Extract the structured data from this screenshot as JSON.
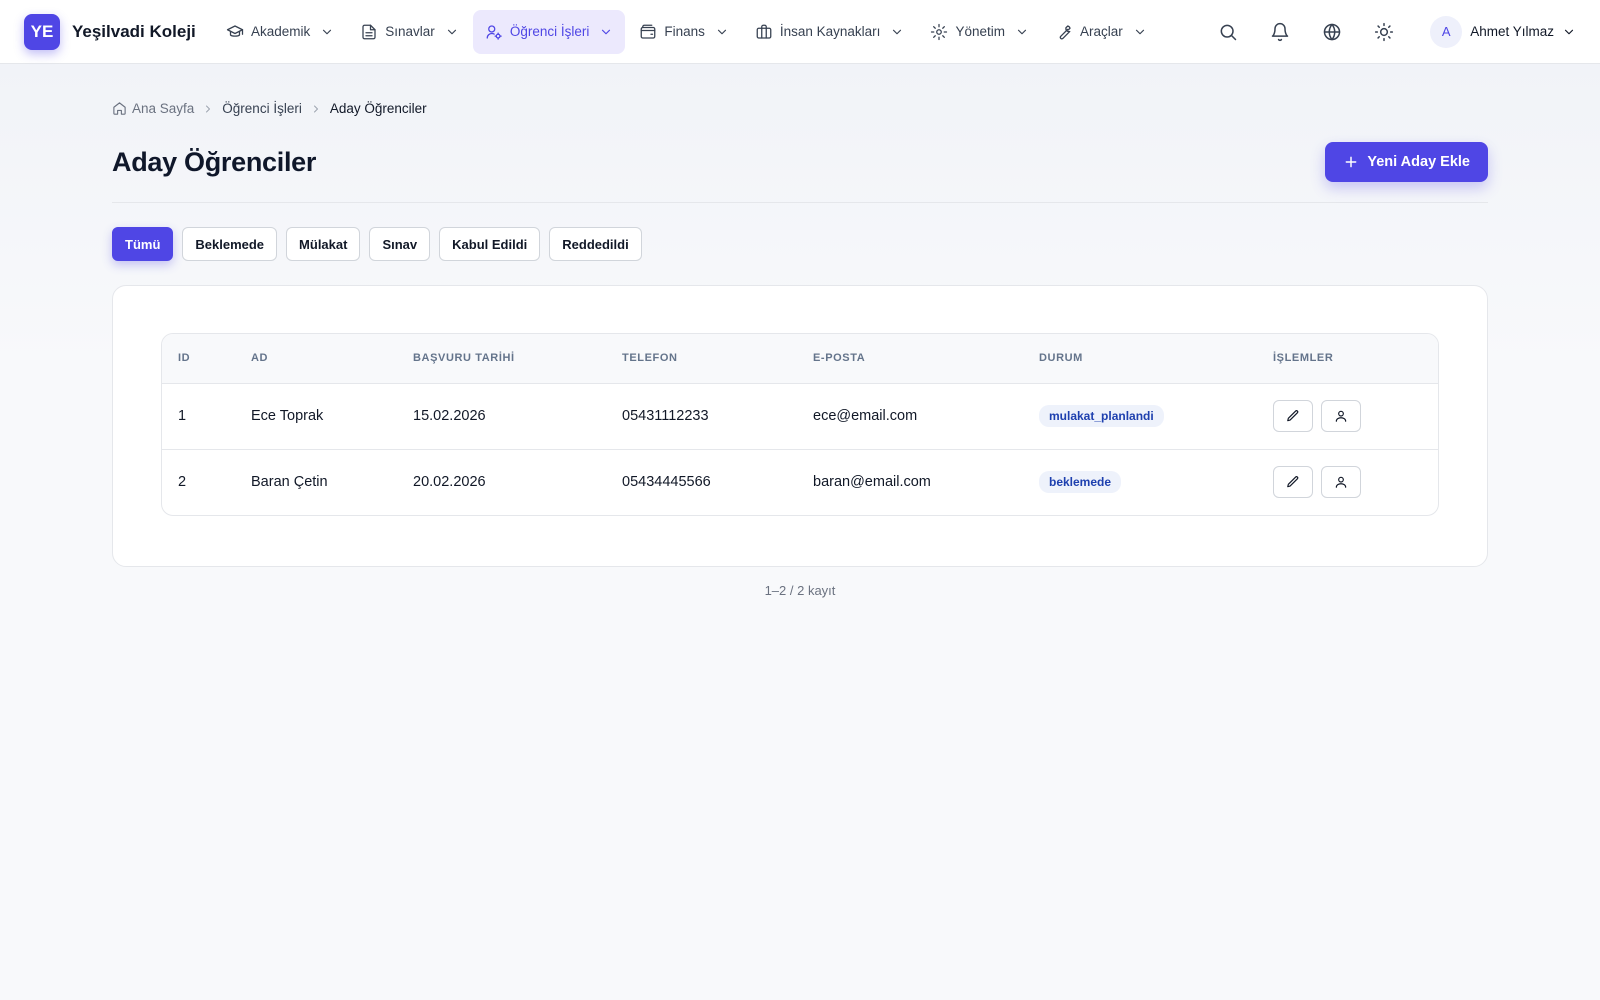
{
  "brand": {
    "logo_text": "YE",
    "name": "Yeşilvadi Koleji"
  },
  "nav": {
    "items": [
      {
        "label": "Akademik",
        "icon": "graduation-cap-icon"
      },
      {
        "label": "Sınavlar",
        "icon": "document-icon"
      },
      {
        "label": "Öğrenci İşleri",
        "icon": "user-cog-icon",
        "active": true
      },
      {
        "label": "Finans",
        "icon": "wallet-icon"
      },
      {
        "label": "İnsan Kaynakları",
        "icon": "briefcase-icon"
      },
      {
        "label": "Yönetim",
        "icon": "gear-icon"
      },
      {
        "label": "Araçlar",
        "icon": "wrench-icon"
      }
    ]
  },
  "topbar": {
    "tools": [
      "search-icon",
      "bell-icon",
      "globe-icon",
      "sun-icon"
    ],
    "user": {
      "avatar_letter": "A",
      "name": "Ahmet Yılmaz"
    }
  },
  "breadcrumb": {
    "home": "Ana Sayfa",
    "section": "Öğrenci İşleri",
    "current": "Aday Öğrenciler"
  },
  "page": {
    "title": "Aday Öğrenciler",
    "add_button": "Yeni Aday Ekle"
  },
  "filters": [
    "Tümü",
    "Beklemede",
    "Mülakat",
    "Sınav",
    "Kabul Edildi",
    "Reddedildi"
  ],
  "table": {
    "headers": [
      "ID",
      "AD",
      "BAŞVURU TARİHİ",
      "TELEFON",
      "E-POSTA",
      "DURUM",
      "İŞLEMLER"
    ],
    "rows": [
      {
        "id": "1",
        "name": "Ece Toprak",
        "date": "15.02.2026",
        "phone": "05431112233",
        "email": "ece@email.com",
        "status": "mulakat_planlandi"
      },
      {
        "id": "2",
        "name": "Baran Çetin",
        "date": "20.02.2026",
        "phone": "05434445566",
        "email": "baran@email.com",
        "status": "beklemede"
      }
    ]
  },
  "footer": {
    "count_text": "1–2 / 2 kayıt"
  },
  "colors": {
    "accent": "#4f46e5",
    "accent_soft": "#ece9fd",
    "badge_text": "#1e40af",
    "badge_bg": "#eef2fb"
  }
}
